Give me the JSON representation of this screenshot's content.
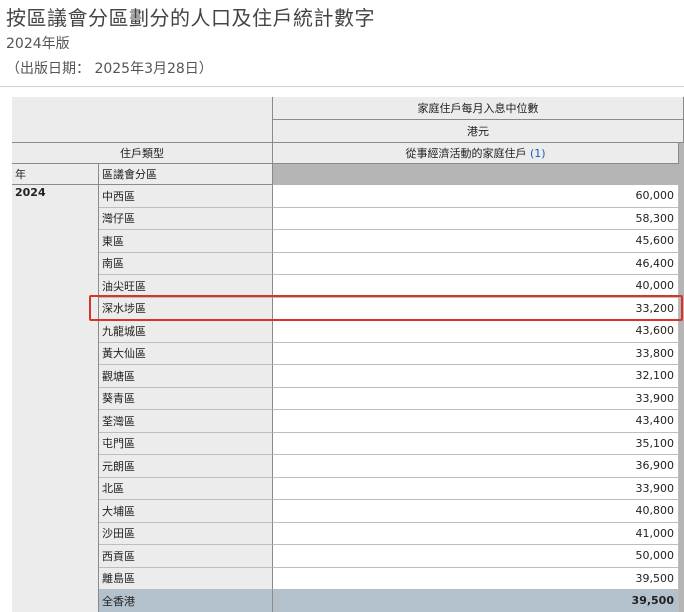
{
  "header": {
    "title": "按區議會分區劃分的人口及住戶統計數字",
    "edition": "2024年版",
    "release": "（出版日期： 2025年3月28日）"
  },
  "table": {
    "col_group": "家庭住戶每月入息中位數",
    "unit": "港元",
    "row_dim": "住戶類型",
    "measure": "從事經濟活動的家庭住戶",
    "footnote_ref": "(1)",
    "year_label": "年",
    "district_label": "區議會分區",
    "year": "2024",
    "rows": [
      {
        "district": "中西區",
        "value": "60,000"
      },
      {
        "district": "灣仔區",
        "value": "58,300"
      },
      {
        "district": "東區",
        "value": "45,600"
      },
      {
        "district": "南區",
        "value": "46,400"
      },
      {
        "district": "油尖旺區",
        "value": "40,000"
      },
      {
        "district": "深水埗區",
        "value": "33,200"
      },
      {
        "district": "九龍城區",
        "value": "43,600"
      },
      {
        "district": "黃大仙區",
        "value": "33,800"
      },
      {
        "district": "觀塘區",
        "value": "32,100"
      },
      {
        "district": "葵青區",
        "value": "33,900"
      },
      {
        "district": "荃灣區",
        "value": "43,400"
      },
      {
        "district": "屯門區",
        "value": "35,100"
      },
      {
        "district": "元朗區",
        "value": "36,900"
      },
      {
        "district": "北區",
        "value": "33,900"
      },
      {
        "district": "大埔區",
        "value": "40,800"
      },
      {
        "district": "沙田區",
        "value": "41,000"
      },
      {
        "district": "西貢區",
        "value": "50,000"
      },
      {
        "district": "離島區",
        "value": "39,500"
      }
    ],
    "total": {
      "district": "全香港",
      "value": "39,500"
    },
    "highlighted_district": "深水埗區",
    "highlight_color": "#d8352a"
  }
}
